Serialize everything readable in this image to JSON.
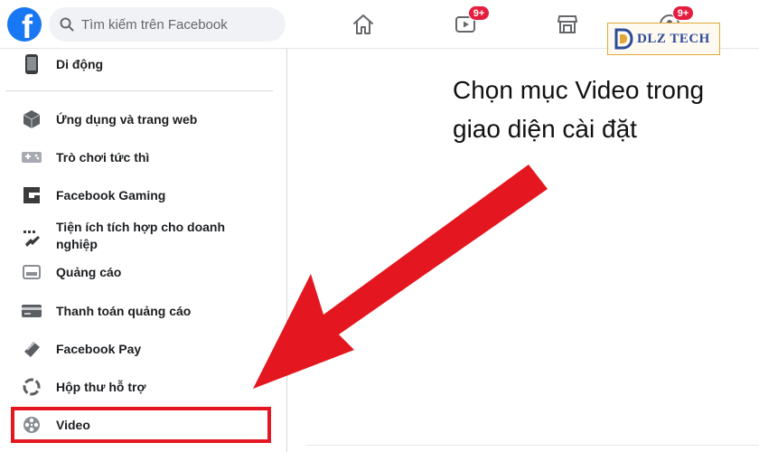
{
  "header": {
    "search_placeholder": "Tìm kiếm trên Facebook",
    "video_badge": "9+",
    "groups_badge": "9+"
  },
  "watermark": {
    "text": "DLZ TECH"
  },
  "sidebar": {
    "items": [
      {
        "label": "Di động",
        "icon": "mobile-phone-icon"
      },
      {
        "label": "Ứng dụng và trang web",
        "icon": "cube-icon"
      },
      {
        "label": "Trò chơi tức thì",
        "icon": "game-controller-icon"
      },
      {
        "label": "Facebook Gaming",
        "icon": "gaming-icon"
      },
      {
        "label": "Tiện ích tích hợp cho doanh nghiệp",
        "icon": "puzzle-icon"
      },
      {
        "label": "Quảng cáo",
        "icon": "ads-icon"
      },
      {
        "label": "Thanh toán quảng cáo",
        "icon": "credit-card-icon"
      },
      {
        "label": "Facebook Pay",
        "icon": "facebook-pay-icon"
      },
      {
        "label": "Hộp thư hỗ trợ",
        "icon": "lifebuoy-icon"
      },
      {
        "label": "Video",
        "icon": "film-reel-icon"
      }
    ]
  },
  "annotation": {
    "text": "Chọn mục Video trong giao diện cài đặt"
  },
  "colors": {
    "facebook_blue": "#1877f2",
    "badge_red": "#e41e3f",
    "highlight_red": "#e4161f"
  }
}
